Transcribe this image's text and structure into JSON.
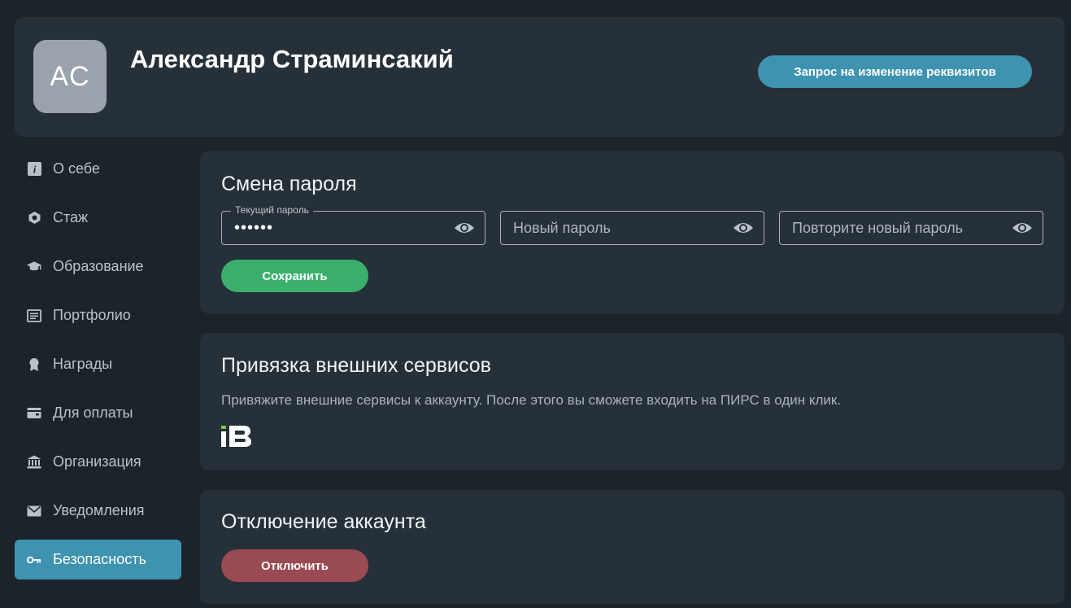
{
  "header": {
    "avatar_initials": "AC",
    "user_name": "Александр Страминсакий",
    "request_button": "Запрос на изменение реквизитов"
  },
  "sidebar": {
    "items": [
      {
        "label": "О себе",
        "icon": "info-icon"
      },
      {
        "label": "Стаж",
        "icon": "hexagon-icon"
      },
      {
        "label": "Образование",
        "icon": "graduation-cap-icon"
      },
      {
        "label": "Портфолио",
        "icon": "document-icon"
      },
      {
        "label": "Награды",
        "icon": "award-icon"
      },
      {
        "label": "Для оплаты",
        "icon": "wallet-icon"
      },
      {
        "label": "Организация",
        "icon": "bank-icon"
      },
      {
        "label": "Уведомления",
        "icon": "envelope-icon"
      },
      {
        "label": "Безопасность",
        "icon": "key-icon",
        "active": true
      }
    ]
  },
  "password_card": {
    "title": "Смена пароля",
    "current_password_label": "Текущий пароль",
    "current_password_value": "••••••",
    "new_password_placeholder": "Новый пароль",
    "repeat_password_placeholder": "Повторите новый пароль",
    "save_button": "Сохранить"
  },
  "services_card": {
    "title": "Привязка внешних сервисов",
    "description": "Привяжите внешние сервисы к аккаунту. После этого вы сможете входить на ПИРС в один клик.",
    "service_logo": "iB"
  },
  "disable_card": {
    "title": "Отключение аккаунта",
    "disable_button": "Отключить"
  },
  "colors": {
    "background": "#1c232b",
    "card": "#263039",
    "accent": "#3d93b0",
    "save": "#3bb06d",
    "danger": "#9a4a52"
  }
}
